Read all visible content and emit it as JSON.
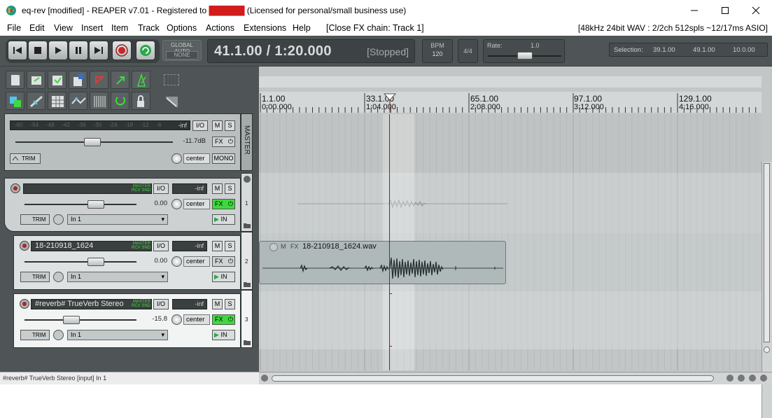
{
  "window": {
    "title_prefix": "eq-rev [modified] - REAPER v7.01 - Registered to ",
    "title_redacted": "██████",
    "title_suffix": " (Licensed for personal/small business use)",
    "minimize_icon": "minimize-icon",
    "maximize_icon": "maximize-icon",
    "close_icon": "close-icon"
  },
  "menu": {
    "items": [
      "File",
      "Edit",
      "View",
      "Insert",
      "Item",
      "Track",
      "Options",
      "Actions",
      "Extensions",
      "Help",
      "[Close FX chain: Track 1]"
    ],
    "audio_info": "[48kHz 24bit WAV : 2/2ch 512spls ~12/17ms ASIO]"
  },
  "transport": {
    "global_auto_label": "GLOBAL AUTO",
    "global_auto_value": "NONE",
    "time": "41.1.00 / 1:20.000",
    "state": "[Stopped]",
    "bpm_label": "BPM",
    "bpm_value": "120",
    "time_sig": "4/4",
    "rate_label": "Rate:",
    "rate_value": "1.0",
    "rate_level": 0.5,
    "selection_label": "Selection:",
    "selection_start": "39.1.00",
    "selection_end": "49.1.00",
    "selection_length": "10.0.00"
  },
  "master": {
    "label": "MASTER",
    "vu_scale": [
      "-60",
      "-54",
      "-48",
      "-42",
      "-36",
      "-30",
      "-24",
      "-18",
      "-12",
      "-6"
    ],
    "vu_value": "-inf",
    "io_label": "I/O",
    "mute_label": "M",
    "solo_label": "S",
    "volume_db": "-11.7dB",
    "fx_label": "FX",
    "trim_label": "TRIM",
    "pan_label": "center",
    "mono_label": "MONO"
  },
  "tracks": [
    {
      "num": "1",
      "name": "",
      "volume": "0.00",
      "vol_mini": "-inf",
      "input": "In 1",
      "fx_active": true,
      "fader_level": 0.64
    },
    {
      "num": "2",
      "name": "18-210918_1624",
      "volume": "0.00",
      "vol_mini": "-inf",
      "input": "In 1",
      "fx_active": false,
      "fader_level": 0.64
    },
    {
      "num": "3",
      "name": "#reverb# TrueVerb Stereo",
      "volume": "-15.8",
      "vol_mini": "-inf",
      "input": "In 1",
      "fx_active": true,
      "fader_level": 0.42
    }
  ],
  "track_common": {
    "routing_master": "MASTER",
    "routing_rcv": "RCV SND",
    "io_label": "I/O",
    "mute_label": "M",
    "solo_label": "S",
    "fx_label": "FX",
    "trim_label": "TRIM",
    "pan_label": "center",
    "in_label": "IN"
  },
  "ruler": {
    "bars": [
      {
        "bar": "1.1.00",
        "time": "0:00.000"
      },
      {
        "bar": "33.1.00",
        "time": "1:04.000"
      },
      {
        "bar": "65.1.00",
        "time": "2:08.000"
      },
      {
        "bar": "97.1.00",
        "time": "3:12.000"
      },
      {
        "bar": "129.1.00",
        "time": "4:16.000"
      }
    ]
  },
  "item": {
    "name": "18-210918_1624.wav",
    "m_label": "M",
    "fx_label": "FX"
  },
  "status": {
    "text": "#reverb# TrueVerb Stereo [input] In 1"
  },
  "colors": {
    "theme_bg": "#4f5556",
    "arrange_bg": "#c2c6c6",
    "fx_active": "#3fd93f",
    "cursor": "#8a1f1f"
  }
}
